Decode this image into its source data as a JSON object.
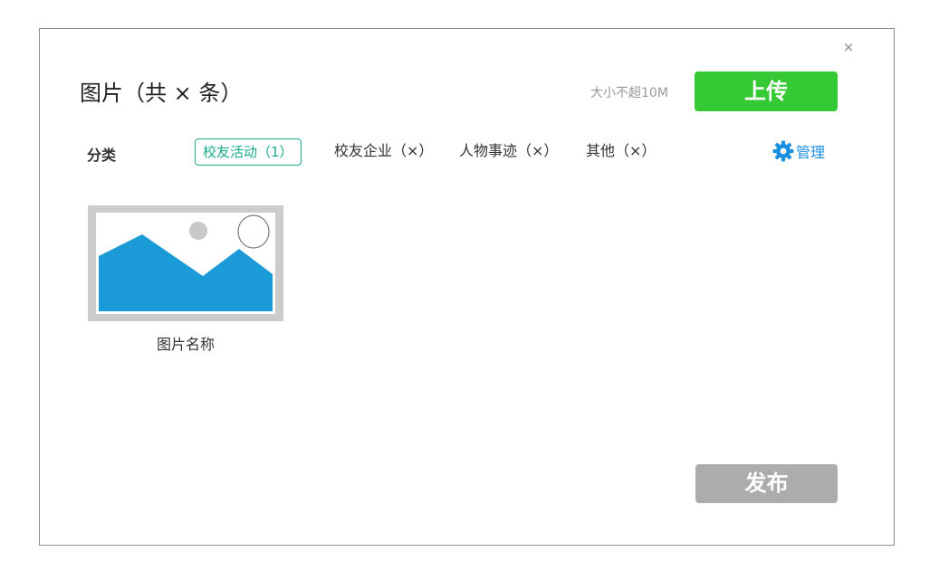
{
  "dialog": {
    "close_label": "×",
    "title": "图片（共 × 条）",
    "size_hint": "大小不超10M",
    "upload_label": "上传",
    "publish_label": "发布"
  },
  "category": {
    "label": "分类",
    "tabs": [
      {
        "label": "校友活动（1）",
        "active": true
      },
      {
        "label": "校友企业（×）",
        "active": false
      },
      {
        "label": "人物事迹（×）",
        "active": false
      },
      {
        "label": "其他（×）",
        "active": false
      }
    ],
    "manage_label": "管理",
    "manage_icon": "gear-icon"
  },
  "images": [
    {
      "caption": "图片名称",
      "icon": "image-placeholder-icon"
    }
  ],
  "colors": {
    "upload": "#35c935",
    "active_tab": "#1aab8a",
    "manage": "#1a8fe0",
    "publish_disabled": "#acacac",
    "thumb_fill": "#1a9ad6"
  }
}
